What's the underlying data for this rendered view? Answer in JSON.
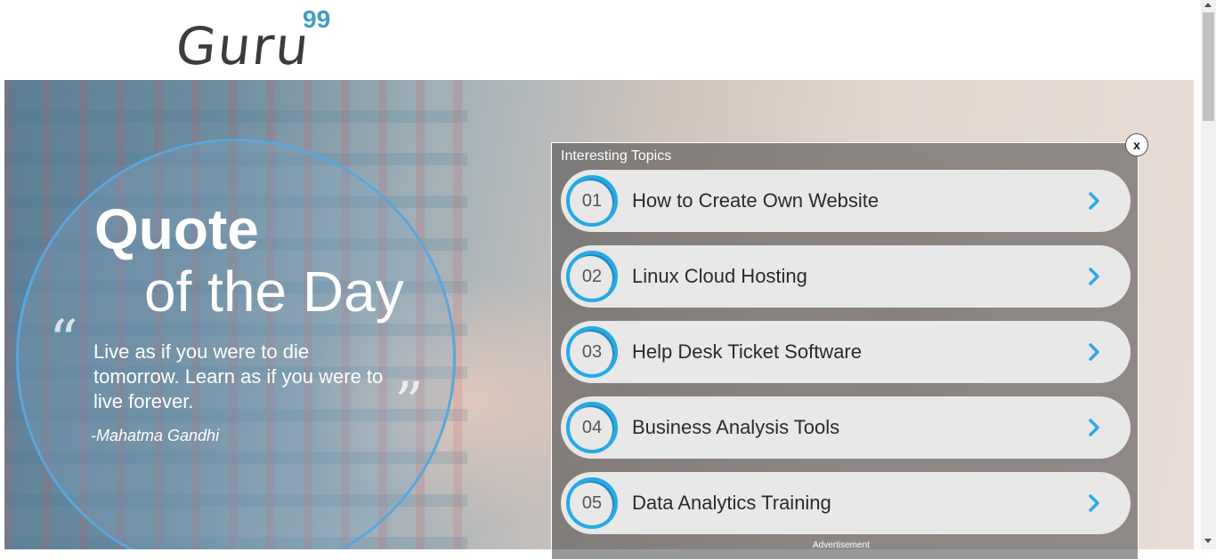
{
  "logo": {
    "text": "Guru",
    "sup": "99"
  },
  "quote": {
    "title_line1": "Quote",
    "title_line2": "of the Day",
    "open_mark": "“",
    "close_mark": "”",
    "text": "Live as if you were to die tomorrow. Learn as if you were to live forever.",
    "author": "-Mahatma Gandhi"
  },
  "topics": {
    "title": "Interesting Topics",
    "close_label": "x",
    "items": [
      {
        "number": "01",
        "label": "How to Create Own Website"
      },
      {
        "number": "02",
        "label": "Linux Cloud Hosting"
      },
      {
        "number": "03",
        "label": "Help Desk Ticket Software"
      },
      {
        "number": "04",
        "label": "Business Analysis Tools"
      },
      {
        "number": "05",
        "label": "Data Analytics Training"
      }
    ],
    "footer_label": "Advertisement"
  },
  "colors": {
    "accent": "#26a9e6",
    "arrow": "#2fa8e6",
    "item_bg": "#e8e8e8",
    "logo_sup": "#3e9ec6"
  },
  "icons": {
    "arrow": "chevron-right-icon",
    "close": "close-icon"
  }
}
